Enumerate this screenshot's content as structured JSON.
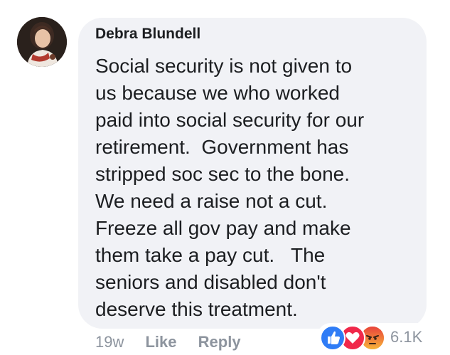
{
  "comment": {
    "author": "Debra Blundell",
    "text": "Social security is not given to\nus because we who worked\npaid into social security for our\nretirement.  Government has\nstripped soc sec to the bone.\nWe need a raise not a cut.\nFreeze all gov pay and make\nthem take a pay cut.   The\nseniors and disabled don't\ndeserve this treatment."
  },
  "meta": {
    "age": "19w",
    "like_label": "Like",
    "reply_label": "Reply"
  },
  "reactions": {
    "icons": [
      "like-icon",
      "love-icon",
      "angry-icon"
    ],
    "count": "6.1K",
    "colors": {
      "like": "#2f7cf6",
      "love": "#f0284a",
      "angry": "#f49b2f"
    }
  }
}
